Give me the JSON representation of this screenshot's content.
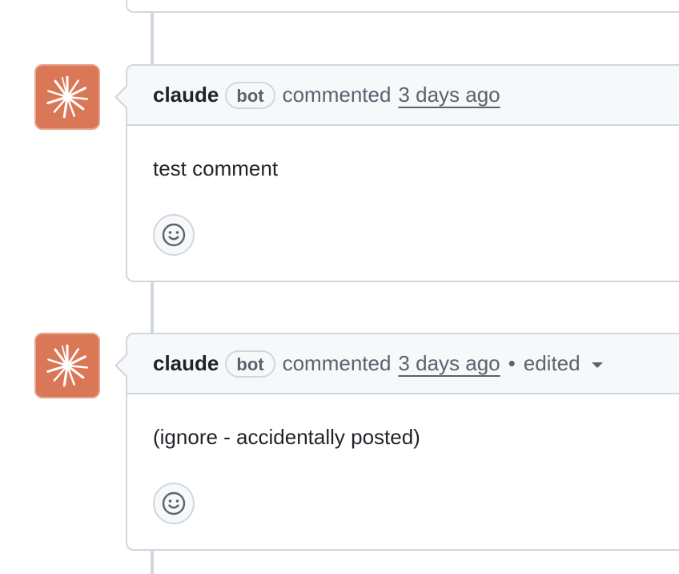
{
  "comments": [
    {
      "author": "claude",
      "badge": "bot",
      "action": "commented",
      "timestamp": "3 days ago",
      "body": "test comment",
      "edited": false
    },
    {
      "author": "claude",
      "badge": "bot",
      "action": "commented",
      "timestamp": "3 days ago",
      "separator": "•",
      "edited_label": "edited",
      "body": "(ignore - accidentally posted)",
      "edited": true
    }
  ],
  "icons": {
    "avatar": "claude-starburst-icon",
    "reaction": "smiley-icon",
    "edit_history": "chevron-down-icon"
  },
  "colors": {
    "avatar_bg": "#d97757",
    "border": "#d0d7de",
    "header_bg": "#f6f8fa",
    "muted_text": "#59636e"
  }
}
